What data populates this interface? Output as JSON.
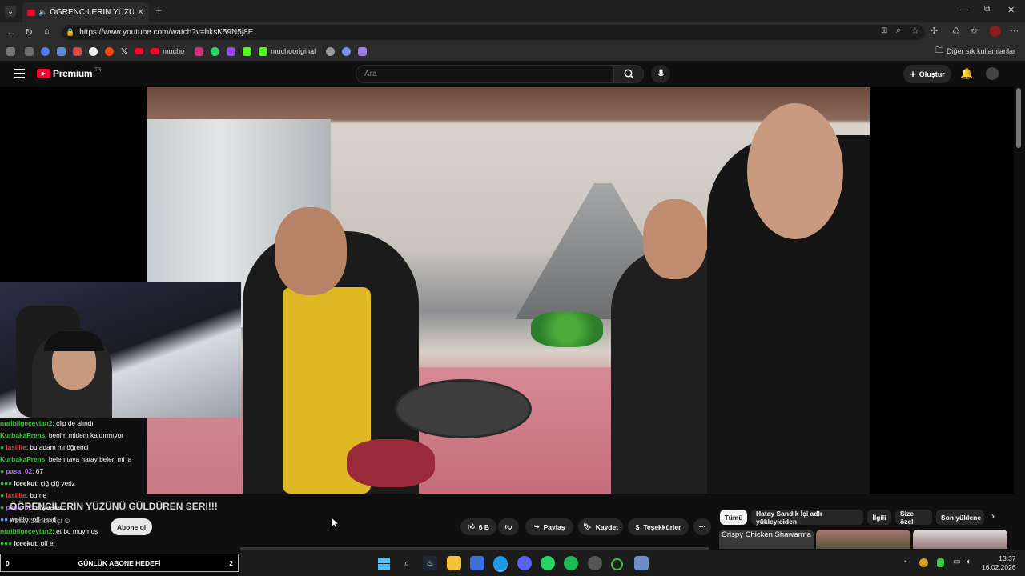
{
  "browser": {
    "tab_title": "ÖĞRENCİLERİN YÜZÜNÜ GÜL",
    "url": "https://www.youtube.com/watch?v=hksK59N5j8E",
    "bookmarks": [
      "mucho",
      "muchooriginal"
    ],
    "bookmarks_other": "Diğer sık kullanılanlar"
  },
  "youtube": {
    "logo_text": "Premium",
    "logo_region": "TR",
    "search_placeholder": "Ara",
    "create_label": "Oluştur",
    "video_title": "ÖĞRENCİLERİN YÜZÜNÜ GÜLDÜREN SERİ!!!",
    "channel_name": "Hatay Sandık İçi",
    "subscribe_label": "Abone ol",
    "like_count": "6 B",
    "share_label": "Paylaş",
    "save_label": "Kaydet",
    "thanks_label": "Teşekkürler",
    "chips": [
      "Tümü",
      "Hatay Sandık İçi adlı yükleyiciden",
      "İlgili",
      "Size özel",
      "Son yüklene"
    ],
    "thumb1_title": "Crispy Chicken Shawarma"
  },
  "chat": [
    {
      "user": "nuribilgeceylan2",
      "color": "#3ec43e",
      "text": ": clip de alındı"
    },
    {
      "user": "KurbakaPrens",
      "color": "#3ec43e",
      "text": ": benim midem kaldırmıyor"
    },
    {
      "user": "lasillie",
      "color": "#d04a4a",
      "text": ": bu adam mı öğrenci"
    },
    {
      "user": "KurbakaPrens",
      "color": "#3ec43e",
      "text": ": belen tava hatay belen mi la"
    },
    {
      "user": "pasa_02",
      "color": "#b56cf0",
      "text": ": 67"
    },
    {
      "user": "iceekut",
      "color": "#e0e0e0",
      "text": ": çiğ çiğ yeriz"
    },
    {
      "user": "lasillie",
      "color": "#d04a4a",
      "text": ": bu ne"
    },
    {
      "user": "pasa_02",
      "color": "#b56cf0",
      "text": ": et yaaaa"
    },
    {
      "user": "wpillo",
      "color": "#e0e0e0",
      "text": ": off nasıl"
    },
    {
      "user": "nuribilgeceylan2",
      "color": "#3ec43e",
      "text": ": et bu muymuş"
    },
    {
      "user": "iceekut",
      "color": "#e0e0e0",
      "text": ": off el"
    }
  ],
  "goal": {
    "left": "0",
    "label": "GÜNLÜK ABONE HEDEFİ",
    "right": "2"
  },
  "clock": {
    "time": "13:37",
    "date": "16.02.2026"
  },
  "colors": {
    "youtube_red": "#ff0033",
    "background": "#0f0f0f"
  }
}
